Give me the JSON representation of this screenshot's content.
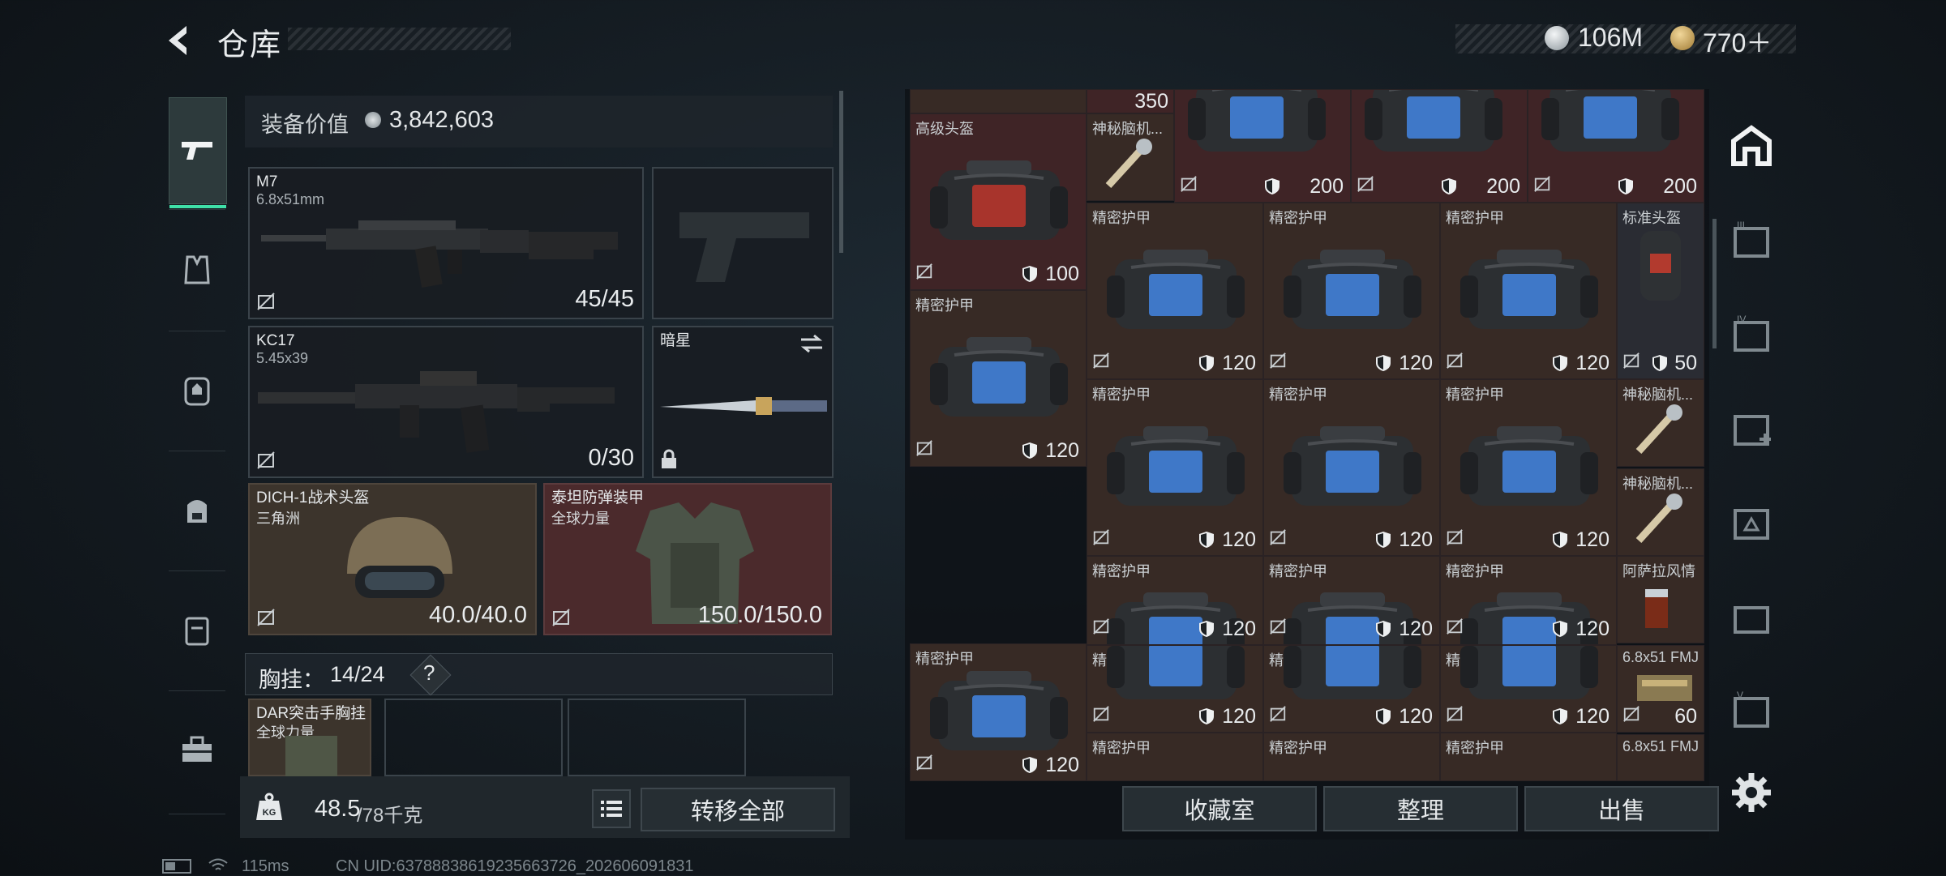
{
  "header": {
    "title": "仓库",
    "currency1": "106M",
    "currency2": "770＋"
  },
  "equipment": {
    "value_label": "装备价值",
    "value": "3,842,603",
    "primary": {
      "name": "M7",
      "caliber": "6.8x51mm",
      "ammo": "45/45"
    },
    "secondary": {
      "name": "KC17",
      "caliber": "5.45x39",
      "ammo": "0/30"
    },
    "melee": {
      "name": "暗星"
    },
    "helmet": {
      "name": "DICH-1战术头盔",
      "faction": "三角洲",
      "durability": "40.0/40.0"
    },
    "armor": {
      "name": "泰坦防弹装甲",
      "faction": "全球力量",
      "durability": "150.0/150.0"
    },
    "chest_label": "胸挂：",
    "chest_capacity": "14/24",
    "help": "?",
    "chest_item": {
      "name": "DAR突击手胸挂",
      "faction": "全球力量"
    }
  },
  "footer": {
    "weight": "48.5",
    "weight_max": "/78千克",
    "transfer_all": "转移全部"
  },
  "grid": {
    "top_row": [
      {
        "name": "",
        "value": "350"
      },
      {
        "name": "",
        "value": "200"
      },
      {
        "name": "",
        "value": "200"
      },
      {
        "name": "",
        "value": "200"
      }
    ],
    "items": [
      {
        "name": "高级头盔",
        "value": "100"
      },
      {
        "name": "神秘脑机...",
        "value": ""
      },
      {
        "name": "精密护甲",
        "value": "120"
      },
      {
        "name": "精密护甲",
        "value": "120"
      },
      {
        "name": "精密护甲",
        "value": "120"
      },
      {
        "name": "标准头盔",
        "value": "50"
      },
      {
        "name": "精密护甲",
        "value": "120"
      },
      {
        "name": "精密护甲",
        "value": "120"
      },
      {
        "name": "精密护甲",
        "value": "120"
      },
      {
        "name": "精密护甲",
        "value": "120"
      },
      {
        "name": "神秘脑机...",
        "value": ""
      },
      {
        "name": "神秘脑机...",
        "value": ""
      },
      {
        "name": "精密护甲",
        "value": "120"
      },
      {
        "name": "精密护甲",
        "value": "120"
      },
      {
        "name": "精密护甲",
        "value": "120"
      },
      {
        "name": "精密护甲",
        "value": "120"
      },
      {
        "name": "阿萨拉风情",
        "value": ""
      },
      {
        "name": "精密护甲",
        "value": "120"
      },
      {
        "name": "精密护甲",
        "value": "120"
      },
      {
        "name": "精密护甲",
        "value": "120"
      },
      {
        "name": "6.8x51 FMJ",
        "value": "60"
      },
      {
        "name": "精密护甲",
        "value": ""
      },
      {
        "name": "精密护甲",
        "value": ""
      },
      {
        "name": "精密护甲",
        "value": ""
      },
      {
        "name": "6.8x51 FMJ",
        "value": ""
      }
    ]
  },
  "actions": {
    "collection": "收藏室",
    "organize": "整理",
    "sell": "出售"
  },
  "status": {
    "ping": "115ms",
    "uid": "CN UID:6378883861923566372​6_202606091831"
  },
  "colors": {
    "accent": "#3fe0a8",
    "cell_red": "#3f2426",
    "cell_brown": "#372a25"
  }
}
